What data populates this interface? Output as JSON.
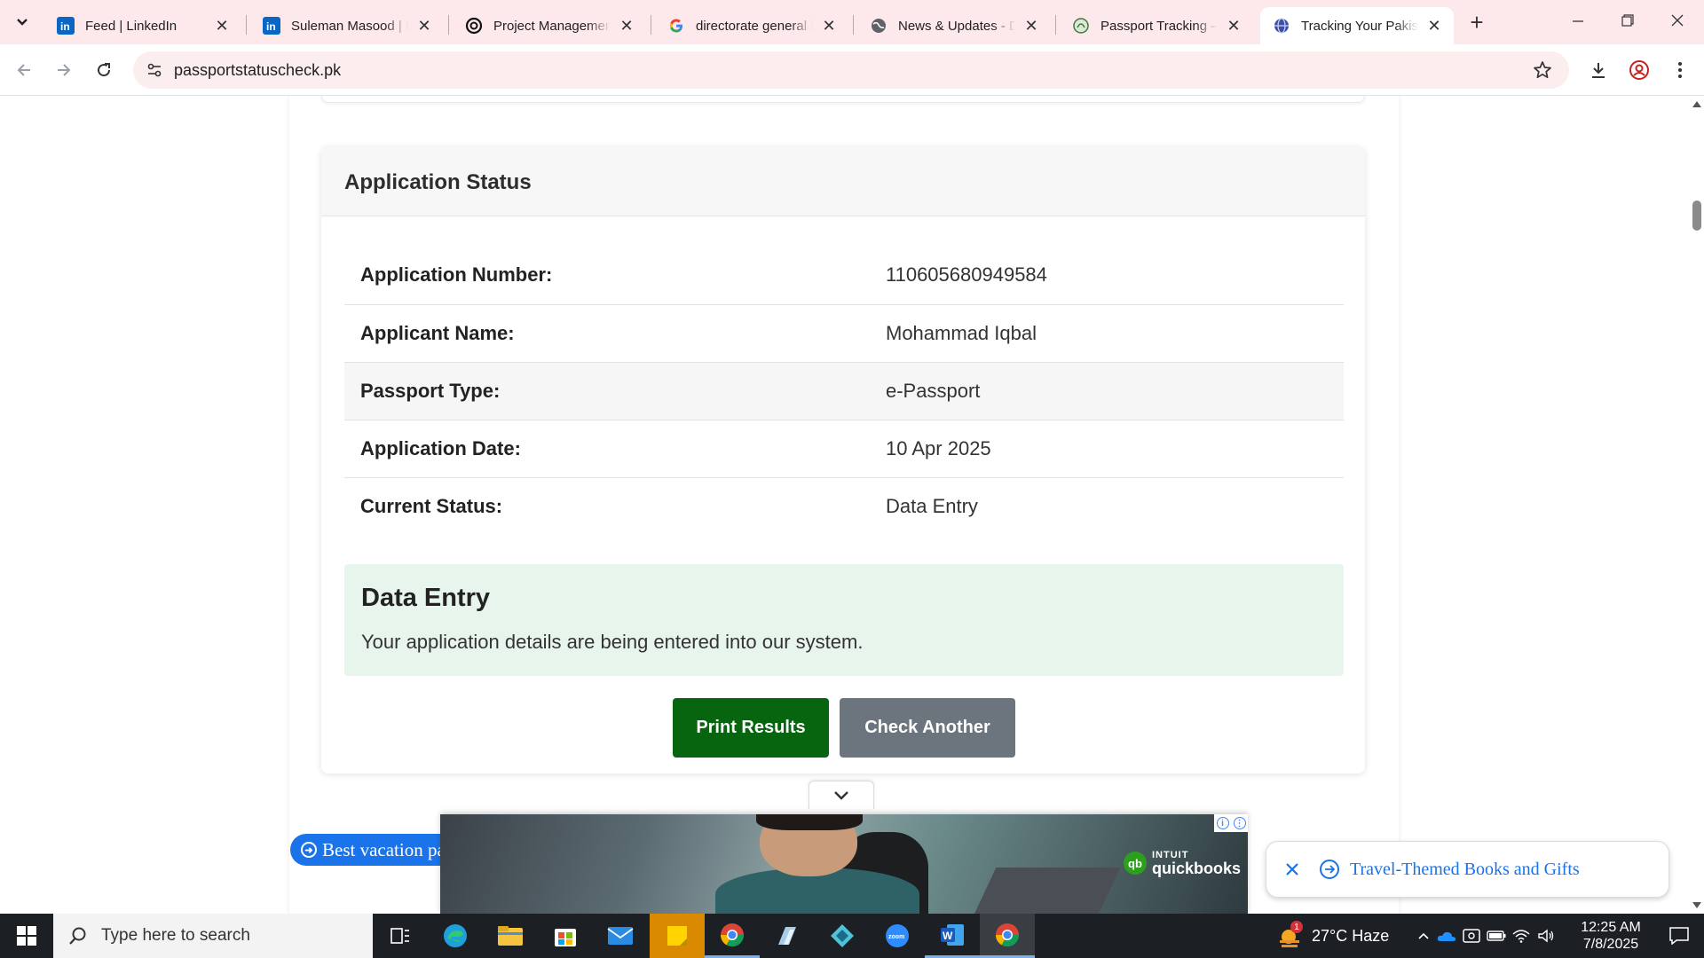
{
  "browser": {
    "tabs": [
      {
        "title": "Feed | LinkedIn",
        "favicon": "linkedin-icon"
      },
      {
        "title": "Suleman Masood | LinkedIn",
        "favicon": "linkedin-icon"
      },
      {
        "title": "Project Management",
        "favicon": "openai-icon"
      },
      {
        "title": "directorate general immigration",
        "favicon": "google-icon"
      },
      {
        "title": "News & Updates - DGIP",
        "favicon": "globe-icon"
      },
      {
        "title": "Passport Tracking – Online",
        "favicon": "pakistan-emblem-icon"
      },
      {
        "title": "Tracking Your Pakistan Passport",
        "favicon": "site-globe-icon",
        "active": true
      }
    ],
    "url": "passportstatuscheck.pk"
  },
  "status_card": {
    "title": "Application Status",
    "rows": [
      {
        "label": "Application Number:",
        "value": "110605680949584"
      },
      {
        "label": "Applicant Name:",
        "value": "Mohammad Iqbal"
      },
      {
        "label": "Passport Type:",
        "value": "e-Passport"
      },
      {
        "label": "Application Date:",
        "value": "10 Apr 2025"
      },
      {
        "label": "Current Status:",
        "value": "Data Entry"
      }
    ],
    "alert": {
      "heading": "Data Entry",
      "message": "Your application details are being entered into our system.",
      "color": "#e8f5ec"
    },
    "buttons": {
      "print": "Print Results",
      "check_another": "Check Another"
    },
    "colors": {
      "print": "#08650f",
      "check_another": "#6c757d"
    }
  },
  "ads": {
    "pill_text": "Best vacation pa",
    "brand_top": "INTUIT",
    "brand_bottom": "quickbooks",
    "card_text": "Travel-Themed Books and Gifts"
  },
  "taskbar": {
    "search_placeholder": "Type here to search",
    "weather": "27°C  Haze",
    "weather_badge": "1",
    "time": "12:25 AM",
    "date": "7/8/2025"
  }
}
